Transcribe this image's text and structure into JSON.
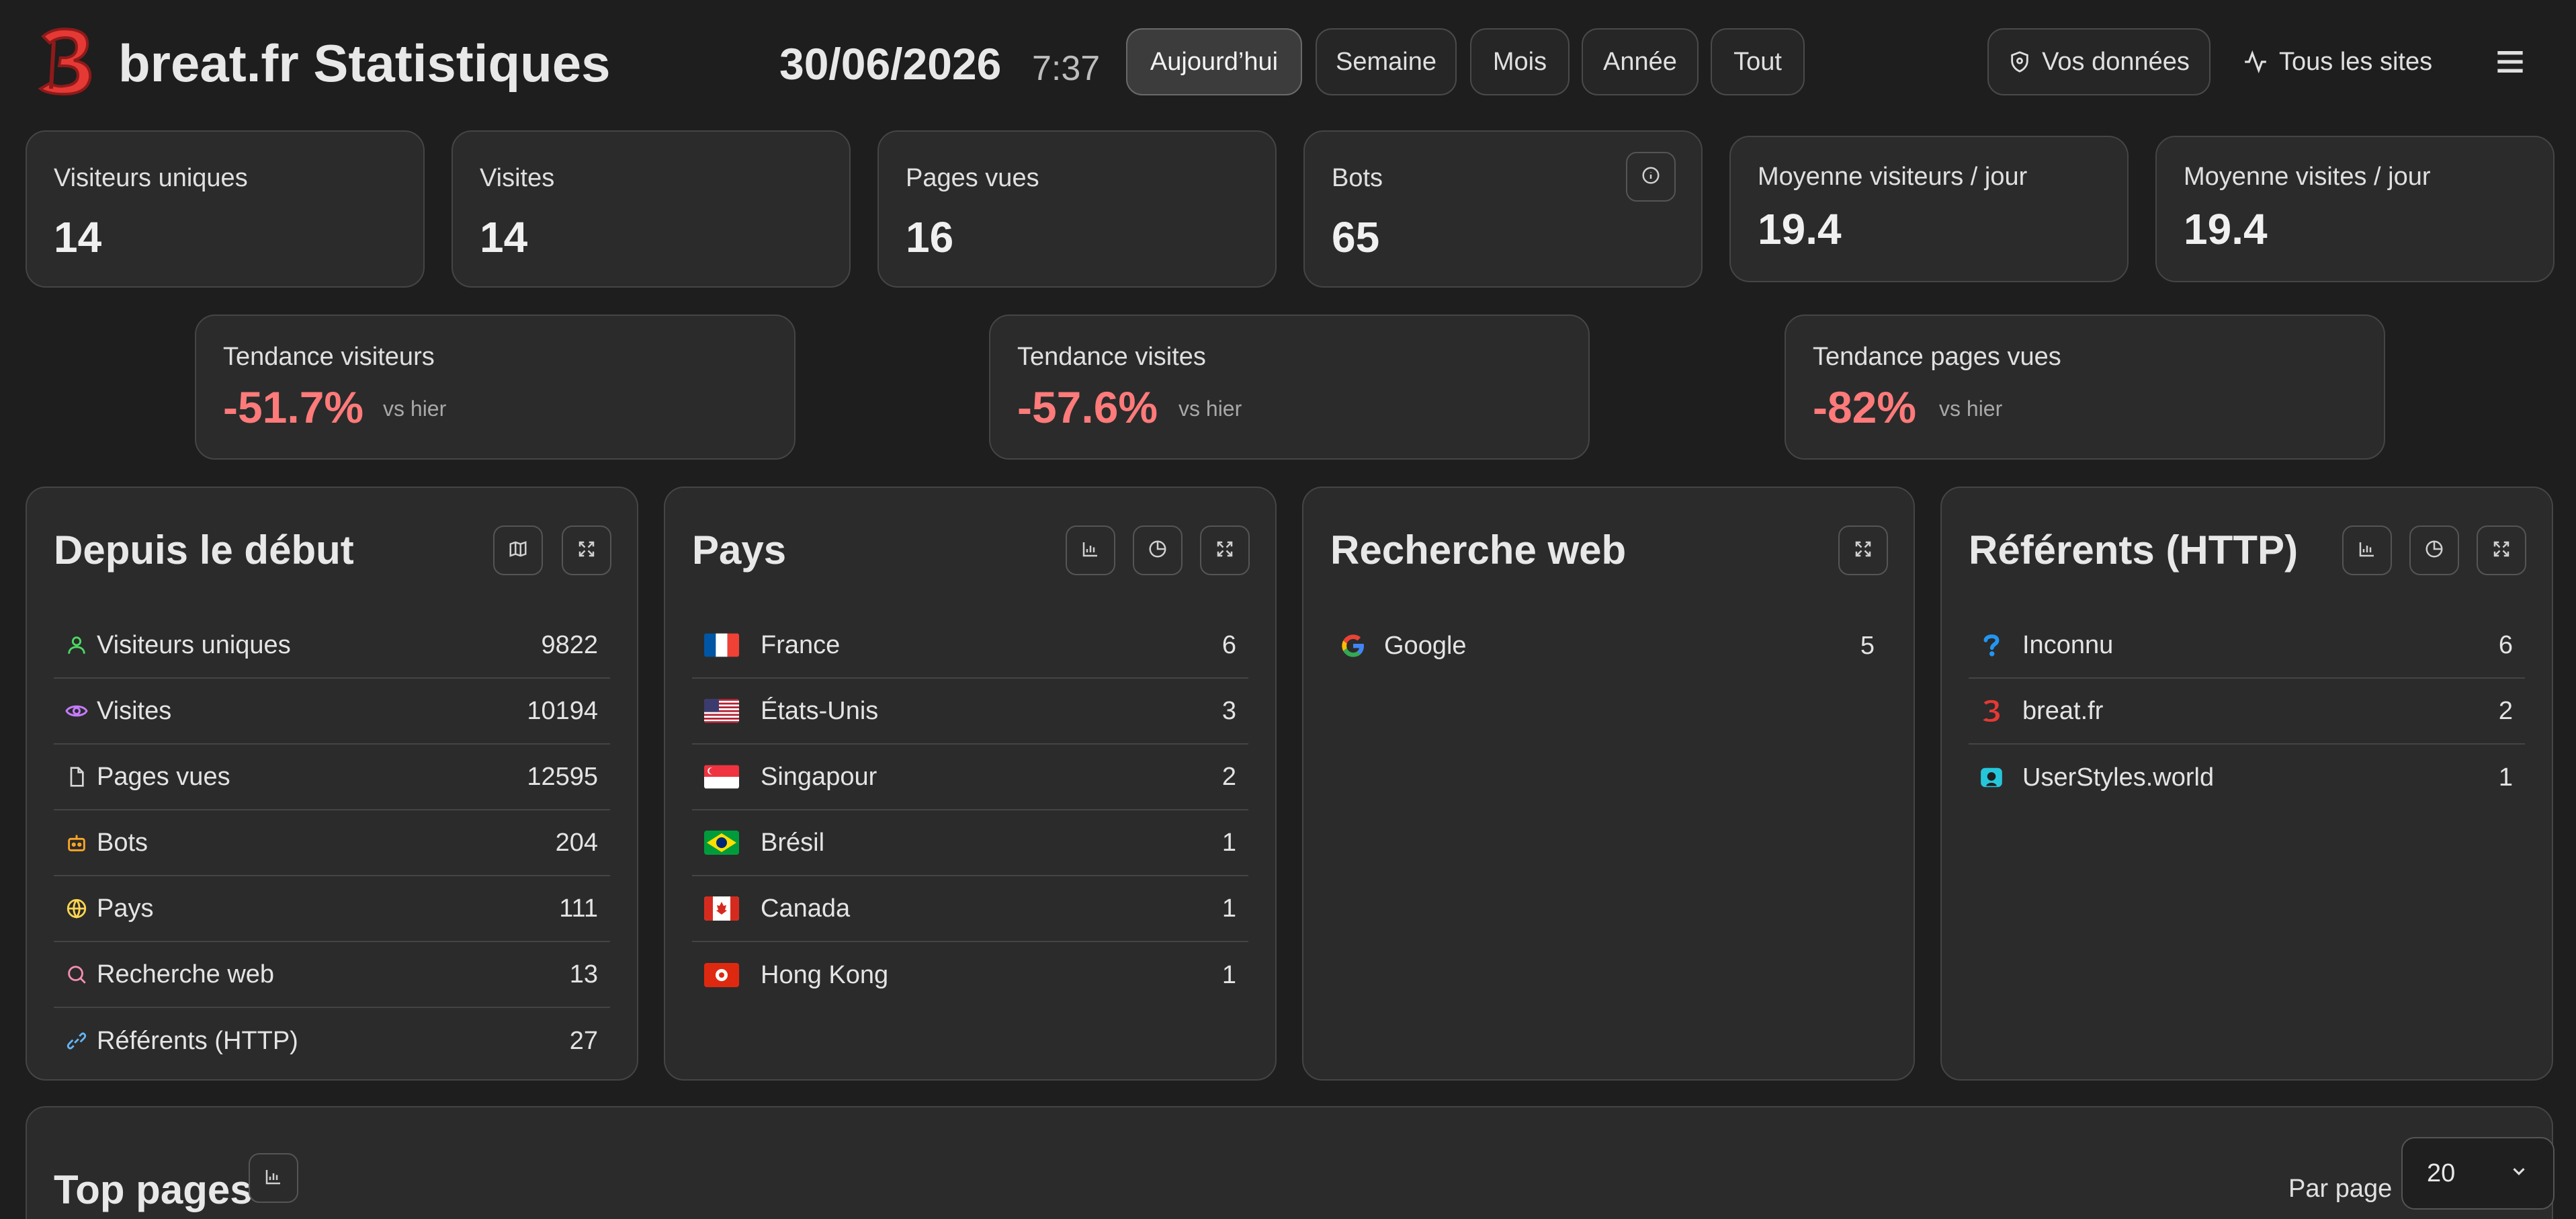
{
  "header": {
    "title": "breat.fr Statistiques",
    "date": "30/06/2026",
    "time": "7:37",
    "periods": [
      "Aujourd’hui",
      "Semaine",
      "Mois",
      "Année",
      "Tout"
    ],
    "active_period": "Aujourd’hui",
    "your_data": "Vos données",
    "all_sites": "Tous les sites"
  },
  "stats": [
    {
      "label": "Visiteurs uniques",
      "value": "14"
    },
    {
      "label": "Visites",
      "value": "14"
    },
    {
      "label": "Pages vues",
      "value": "16"
    },
    {
      "label": "Bots",
      "value": "65"
    },
    {
      "label": "Moyenne visiteurs / jour",
      "value": "19.4"
    },
    {
      "label": "Moyenne visites / jour",
      "value": "19.4"
    }
  ],
  "trends": [
    {
      "label": "Tendance visiteurs",
      "value": "-51.7%",
      "sub": "vs hier"
    },
    {
      "label": "Tendance visites",
      "value": "-57.6%",
      "sub": "vs hier"
    },
    {
      "label": "Tendance pages vues",
      "value": "-82%",
      "sub": "vs hier"
    }
  ],
  "since_start": {
    "title": "Depuis le début",
    "rows": [
      {
        "label": "Visiteurs uniques",
        "value": "9822",
        "icon": "user-icon"
      },
      {
        "label": "Visites",
        "value": "10194",
        "icon": "eye-icon"
      },
      {
        "label": "Pages vues",
        "value": "12595",
        "icon": "file-icon"
      },
      {
        "label": "Bots",
        "value": "204",
        "icon": "bot-icon"
      },
      {
        "label": "Pays",
        "value": "111",
        "icon": "globe-icon"
      },
      {
        "label": "Recherche web",
        "value": "13",
        "icon": "search-icon"
      },
      {
        "label": "Référents (HTTP)",
        "value": "27",
        "icon": "link-icon"
      }
    ]
  },
  "countries": {
    "title": "Pays",
    "rows": [
      {
        "label": "France",
        "value": "6",
        "icon": "flag-fr-icon"
      },
      {
        "label": "États-Unis",
        "value": "3",
        "icon": "flag-us-icon"
      },
      {
        "label": "Singapour",
        "value": "2",
        "icon": "flag-sg-icon"
      },
      {
        "label": "Brésil",
        "value": "1",
        "icon": "flag-br-icon"
      },
      {
        "label": "Canada",
        "value": "1",
        "icon": "flag-ca-icon"
      },
      {
        "label": "Hong Kong",
        "value": "1",
        "icon": "flag-hk-icon"
      }
    ]
  },
  "web_search": {
    "title": "Recherche web",
    "rows": [
      {
        "label": "Google",
        "value": "5",
        "icon": "google-icon"
      }
    ]
  },
  "referrers": {
    "title": "Référents (HTTP)",
    "rows": [
      {
        "label": "Inconnu",
        "value": "6",
        "icon": "question-icon"
      },
      {
        "label": "breat.fr",
        "value": "2",
        "icon": "breat-logo-icon"
      },
      {
        "label": "UserStyles.world",
        "value": "1",
        "icon": "userstyles-icon"
      }
    ]
  },
  "top_pages": {
    "title": "Top pages",
    "per_page_label": "Par page",
    "per_page_value": "20"
  },
  "colors": {
    "background": "#1e1e1e",
    "card": "#2b2b2b",
    "trend_negative": "#ff7a7a",
    "logo_red": "#e53935"
  }
}
